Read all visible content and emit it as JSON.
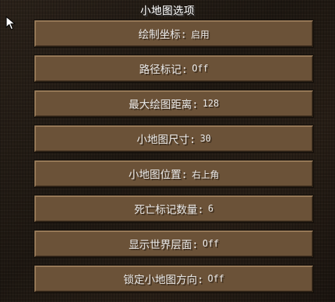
{
  "screen": {
    "title": "小地图选项"
  },
  "options": [
    {
      "label": "绘制坐标:",
      "value": "启用"
    },
    {
      "label": "路径标记:",
      "value": "Off"
    },
    {
      "label": "最大绘图距离:",
      "value": "128"
    },
    {
      "label": "小地图尺寸:",
      "value": "30"
    },
    {
      "label": "小地图位置:",
      "value": "右上角"
    },
    {
      "label": "死亡标记数量:",
      "value": "6"
    },
    {
      "label": "显示世界层面:",
      "value": "Off"
    },
    {
      "label": "锁定小地图方向:",
      "value": "Off"
    }
  ],
  "icons": {
    "cursor": "mouse-pointer-icon"
  },
  "colors": {
    "background": "#1f1812",
    "button_face": "#6b5238",
    "button_highlight": "#9a7c5a",
    "button_shadow": "#2e2216",
    "text": "#e8e8e8",
    "title_text": "#ffffff"
  }
}
